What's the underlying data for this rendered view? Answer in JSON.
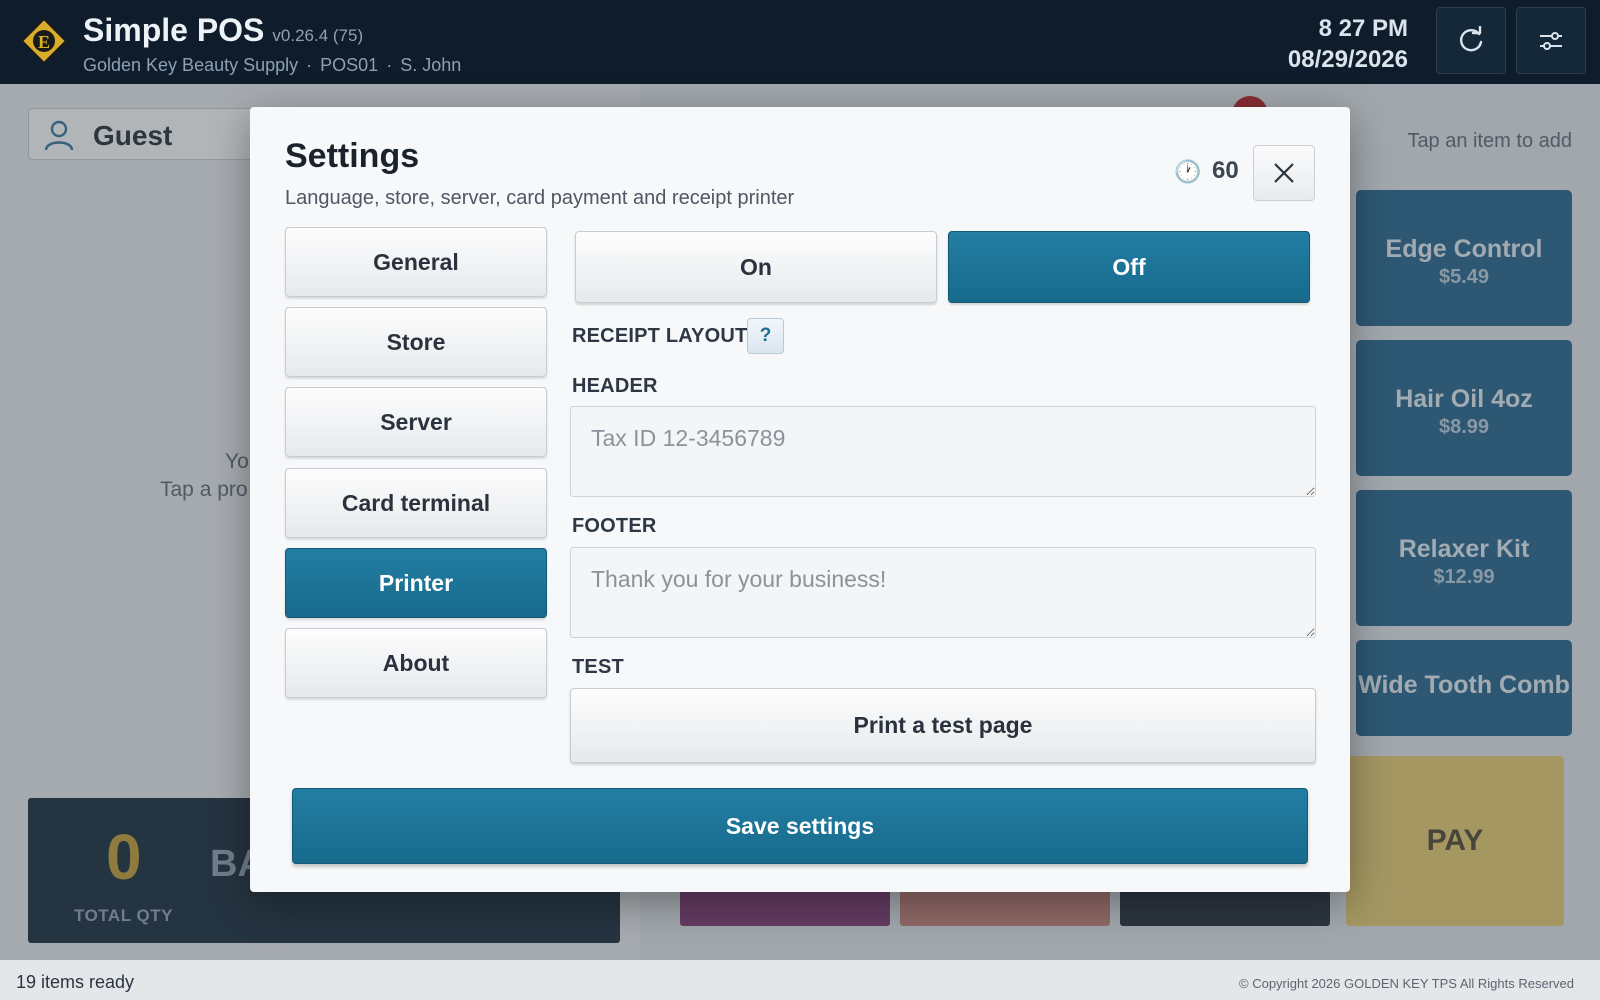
{
  "header": {
    "app_name": "Simple POS",
    "version": "v0.26.4 (75)",
    "store_name": "Golden Key Beauty Supply",
    "register_id": "POS01",
    "cashier": "S. John",
    "separator": "·",
    "time": "8 27 PM",
    "date": "08/29/2026",
    "refresh_icon": "refresh-icon",
    "settings_icon": "sliders-icon"
  },
  "cart": {
    "customer_label": "Guest",
    "empty_line1": "Yo",
    "empty_line2": "Tap a pro",
    "total_qty_value": "0",
    "total_qty_label": "TOTAL QTY",
    "balance_label": "BA"
  },
  "products": {
    "hint": "Tap an item to add",
    "items": [
      {
        "name": "Edge Control",
        "price": "$5.49"
      },
      {
        "name": "Hair Oil 4oz",
        "price": "$8.99"
      },
      {
        "name": "Relaxer Kit",
        "price": "$12.99"
      },
      {
        "name": "Wide Tooth Comb",
        "price": ""
      }
    ],
    "pay_label": "PAY"
  },
  "status": {
    "left": "19 items ready",
    "right": "© Copyright 2026 GOLDEN KEY TPS All Rights Reserved"
  },
  "settings_modal": {
    "title": "Settings",
    "subtitle": "Language, store, server, card payment and receipt printer",
    "timer_icon": "🕐",
    "timer_value": "60",
    "close_icon": "close-icon",
    "nav": [
      {
        "label": "General"
      },
      {
        "label": "Store"
      },
      {
        "label": "Server"
      },
      {
        "label": "Card terminal"
      },
      {
        "label": "Printer",
        "active": true
      },
      {
        "label": "About"
      }
    ],
    "toggle": {
      "on_label": "On",
      "off_label": "Off",
      "selected": "Off"
    },
    "receipt_layout_label": "RECEIPT LAYOUT",
    "help_label": "?",
    "header_label": "HEADER",
    "header_placeholder": "Tax ID 12-3456789",
    "footer_label": "FOOTER",
    "footer_placeholder": "Thank you for your business!",
    "test_label": "TEST",
    "test_button": "Print a test page",
    "save_button": "Save settings"
  },
  "colors": {
    "topbar": "#0e1c2b",
    "accent": "#1b7396",
    "tile": "#1c5e87",
    "pay": "#e8cc6c",
    "gold": "#c59b2c"
  }
}
